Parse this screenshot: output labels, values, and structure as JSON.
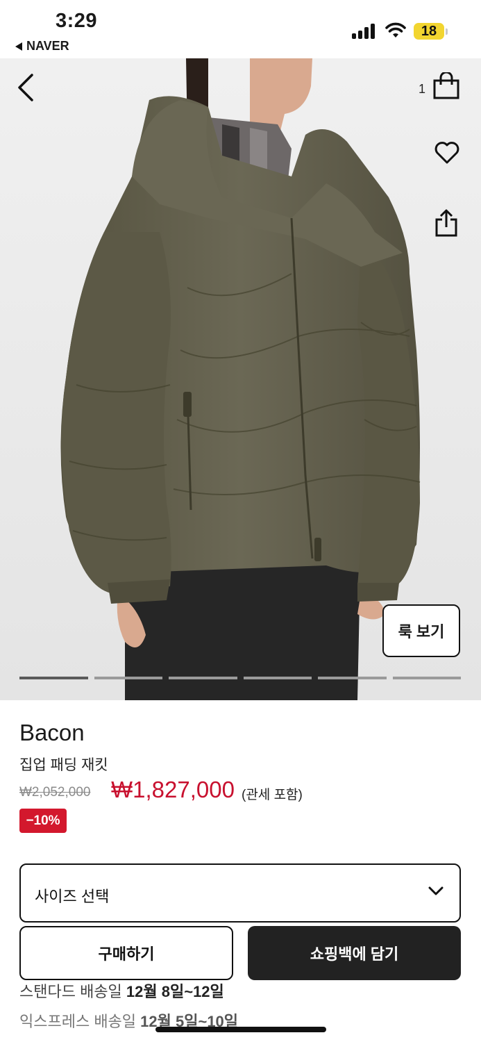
{
  "status_bar": {
    "time": "3:29",
    "back_app": "NAVER",
    "battery": "18"
  },
  "hero": {
    "bag_count": "1",
    "look_button": "룩 보기",
    "carousel": {
      "total": 6,
      "active_index": 0
    },
    "icons": [
      "back-icon",
      "shopping-bag-icon",
      "heart-icon",
      "share-icon"
    ]
  },
  "product": {
    "brand": "Bacon",
    "name": "집업 패딩 재킷",
    "original_price": "₩2,052,000",
    "sale_price": "₩1,827,000",
    "tax_note": "(관세 포함)",
    "discount": "−10%"
  },
  "actions": {
    "size_select": "사이즈 선택",
    "buy": "구매하기",
    "add_to_bag": "쇼핑백에 담기"
  },
  "shipping": {
    "standard_label": "스탠다드 배송일",
    "standard_date": "12월 8일~12일",
    "express_label": "익스프레스 배송일",
    "express_date": "12월 5일~10일"
  },
  "colors": {
    "sale_red": "#c8102e",
    "badge_red": "#d3182d",
    "jacket_olive": "#5f5c4c",
    "cart_button": "#222222"
  }
}
